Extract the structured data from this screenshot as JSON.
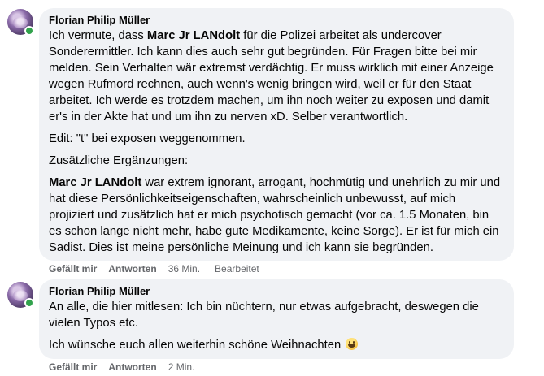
{
  "comments": [
    {
      "author": "Florian Philip Müller",
      "p1_pre": "Ich vermute, dass ",
      "p1_mention": "Marc Jr LANdolt",
      "p1_post": " für die Polizei arbeitet als undercover Sonderermittler. Ich kann dies auch sehr gut begründen. Für Fragen bitte bei mir melden. Sein Verhalten wär extremst verdächtig. Er muss wirklich mit einer Anzeige wegen Rufmord rechnen, auch wenn's wenig bringen wird, weil er für den Staat arbeitet. Ich werde es trotzdem machen, um ihn noch weiter zu exposen und damit er's in der Akte hat und um ihn zu nerven xD. Selber verantwortlich.",
      "p2": "Edit: \"t\" bei exposen weggenommen.",
      "p3": "Zusätzliche Ergänzungen:",
      "p4_mention": "Marc Jr LANdolt",
      "p4_post": " war extrem ignorant, arrogant, hochmütig und unehrlich zu mir und hat diese Persönlichkeitseigenschaften, wahrscheinlich unbewusst, auf mich projiziert und zusätzlich hat er mich psychotisch gemacht (vor ca. 1.5 Monaten, bin es schon lange nicht mehr, habe gute Medikamente, keine Sorge). Er ist für mich ein Sadist. Dies ist meine persönliche Meinung und ich kann sie begründen.",
      "like_label": "Gefällt mir",
      "reply_label": "Antworten",
      "time": "36 Min.",
      "edited": "Bearbeitet"
    },
    {
      "author": "Florian Philip Müller",
      "p1": "An alle, die hier mitlesen: Ich bin nüchtern, nur etwas aufgebracht, deswegen die vielen Typos etc.",
      "p2": "Ich wünsche euch allen weiterhin schöne Weihnachten",
      "emoji": "grinning-face",
      "like_label": "Gefällt mir",
      "reply_label": "Antworten",
      "time": "2 Min."
    }
  ],
  "colors": {
    "bubble": "#f0f2f5",
    "text": "#050505",
    "meta": "#65676b",
    "online": "#31a24c"
  }
}
